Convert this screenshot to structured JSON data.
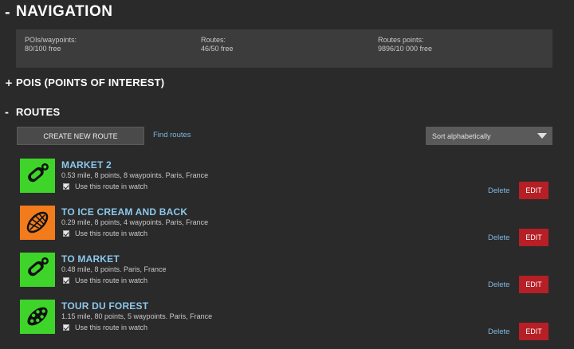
{
  "navigation": {
    "sign": "-",
    "title": "NAVIGATION"
  },
  "stats": [
    {
      "label": "POIs/waypoints:",
      "value": "80/100 free"
    },
    {
      "label": "Routes:",
      "value": "46/50 free"
    },
    {
      "label": "Routes points:",
      "value": "9896/10 000 free"
    }
  ],
  "pois": {
    "sign": "+",
    "title": "POIS (POINTS OF INTEREST)"
  },
  "routes_section": {
    "sign": "-",
    "title": "ROUTES"
  },
  "toolbar": {
    "create_label": "CREATE NEW ROUTE",
    "find_label": "Find routes",
    "sort_value": "Sort alphabetically"
  },
  "colors": {
    "green": "#3fd42a",
    "orange": "#f27b1c",
    "edit_red": "#b51f25",
    "link_blue": "#7fb8e0"
  },
  "routes": [
    {
      "name": "MARKET 2",
      "meta": "0.53 mile, 8 points, 8 waypoints. Paris, France",
      "watch_label": "Use this route in watch",
      "watch_checked": true,
      "delete_label": "Delete",
      "edit_label": "EDIT",
      "icon": "shoe-print-icon",
      "color": "#3fd42a"
    },
    {
      "name": "TO ICE CREAM AND BACK",
      "meta": "0.29 mile, 8 points, 4 waypoints. Paris, France",
      "watch_label": "Use this route in watch",
      "watch_checked": true,
      "delete_label": "Delete",
      "edit_label": "EDIT",
      "icon": "running-shoe-sole-icon",
      "color": "#f27b1c"
    },
    {
      "name": "TO MARKET",
      "meta": "0.48 mile, 8 points. Paris, France",
      "watch_label": "Use this route in watch",
      "watch_checked": true,
      "delete_label": "Delete",
      "edit_label": "EDIT",
      "icon": "shoe-print-icon",
      "color": "#3fd42a"
    },
    {
      "name": "TOUR DU FOREST",
      "meta": "1.15 mile, 80 points, 5 waypoints. Paris, France",
      "watch_label": "Use this route in watch",
      "watch_checked": true,
      "delete_label": "Delete",
      "edit_label": "EDIT",
      "icon": "trail-shoe-sole-icon",
      "color": "#3fd42a"
    }
  ]
}
